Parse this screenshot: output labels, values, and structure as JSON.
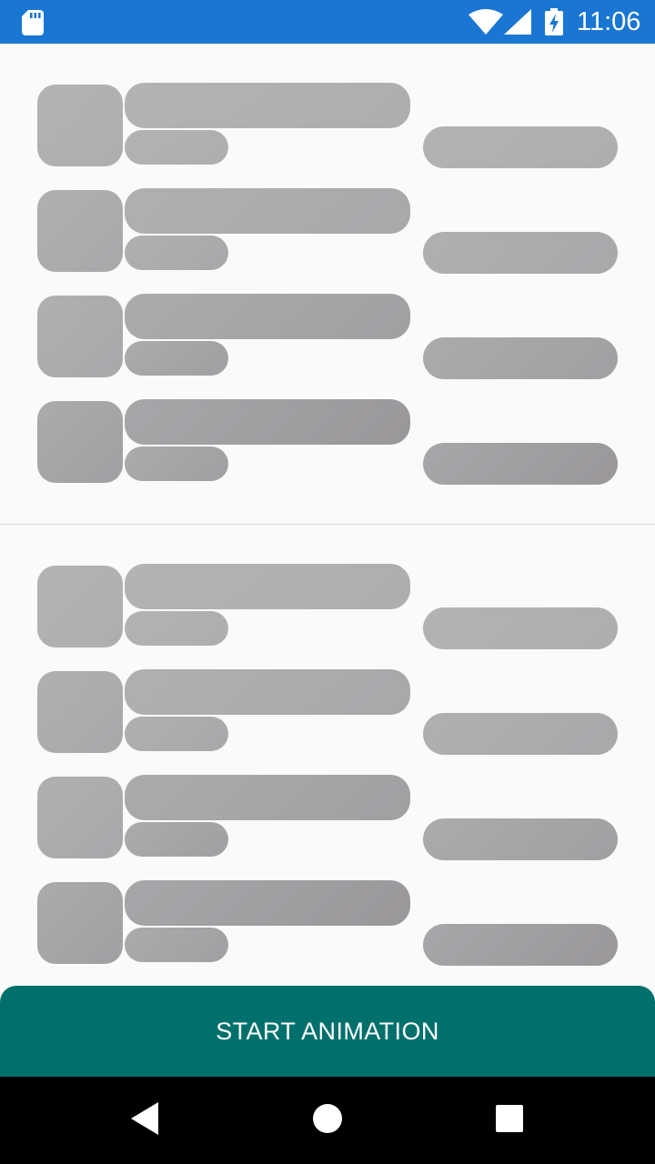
{
  "status_bar": {
    "time": "11:06",
    "icons": [
      "sd-card-icon",
      "wifi-icon",
      "cell-signal-icon",
      "battery-charging-icon"
    ]
  },
  "action": {
    "start_label": "START ANIMATION"
  },
  "navigation": {
    "icons": [
      "back-icon",
      "home-icon",
      "recents-icon"
    ]
  },
  "colors": {
    "status_bar": "#1976d2",
    "button": "#00706c",
    "placeholder": "#b0afb1",
    "background": "#fafafa"
  }
}
